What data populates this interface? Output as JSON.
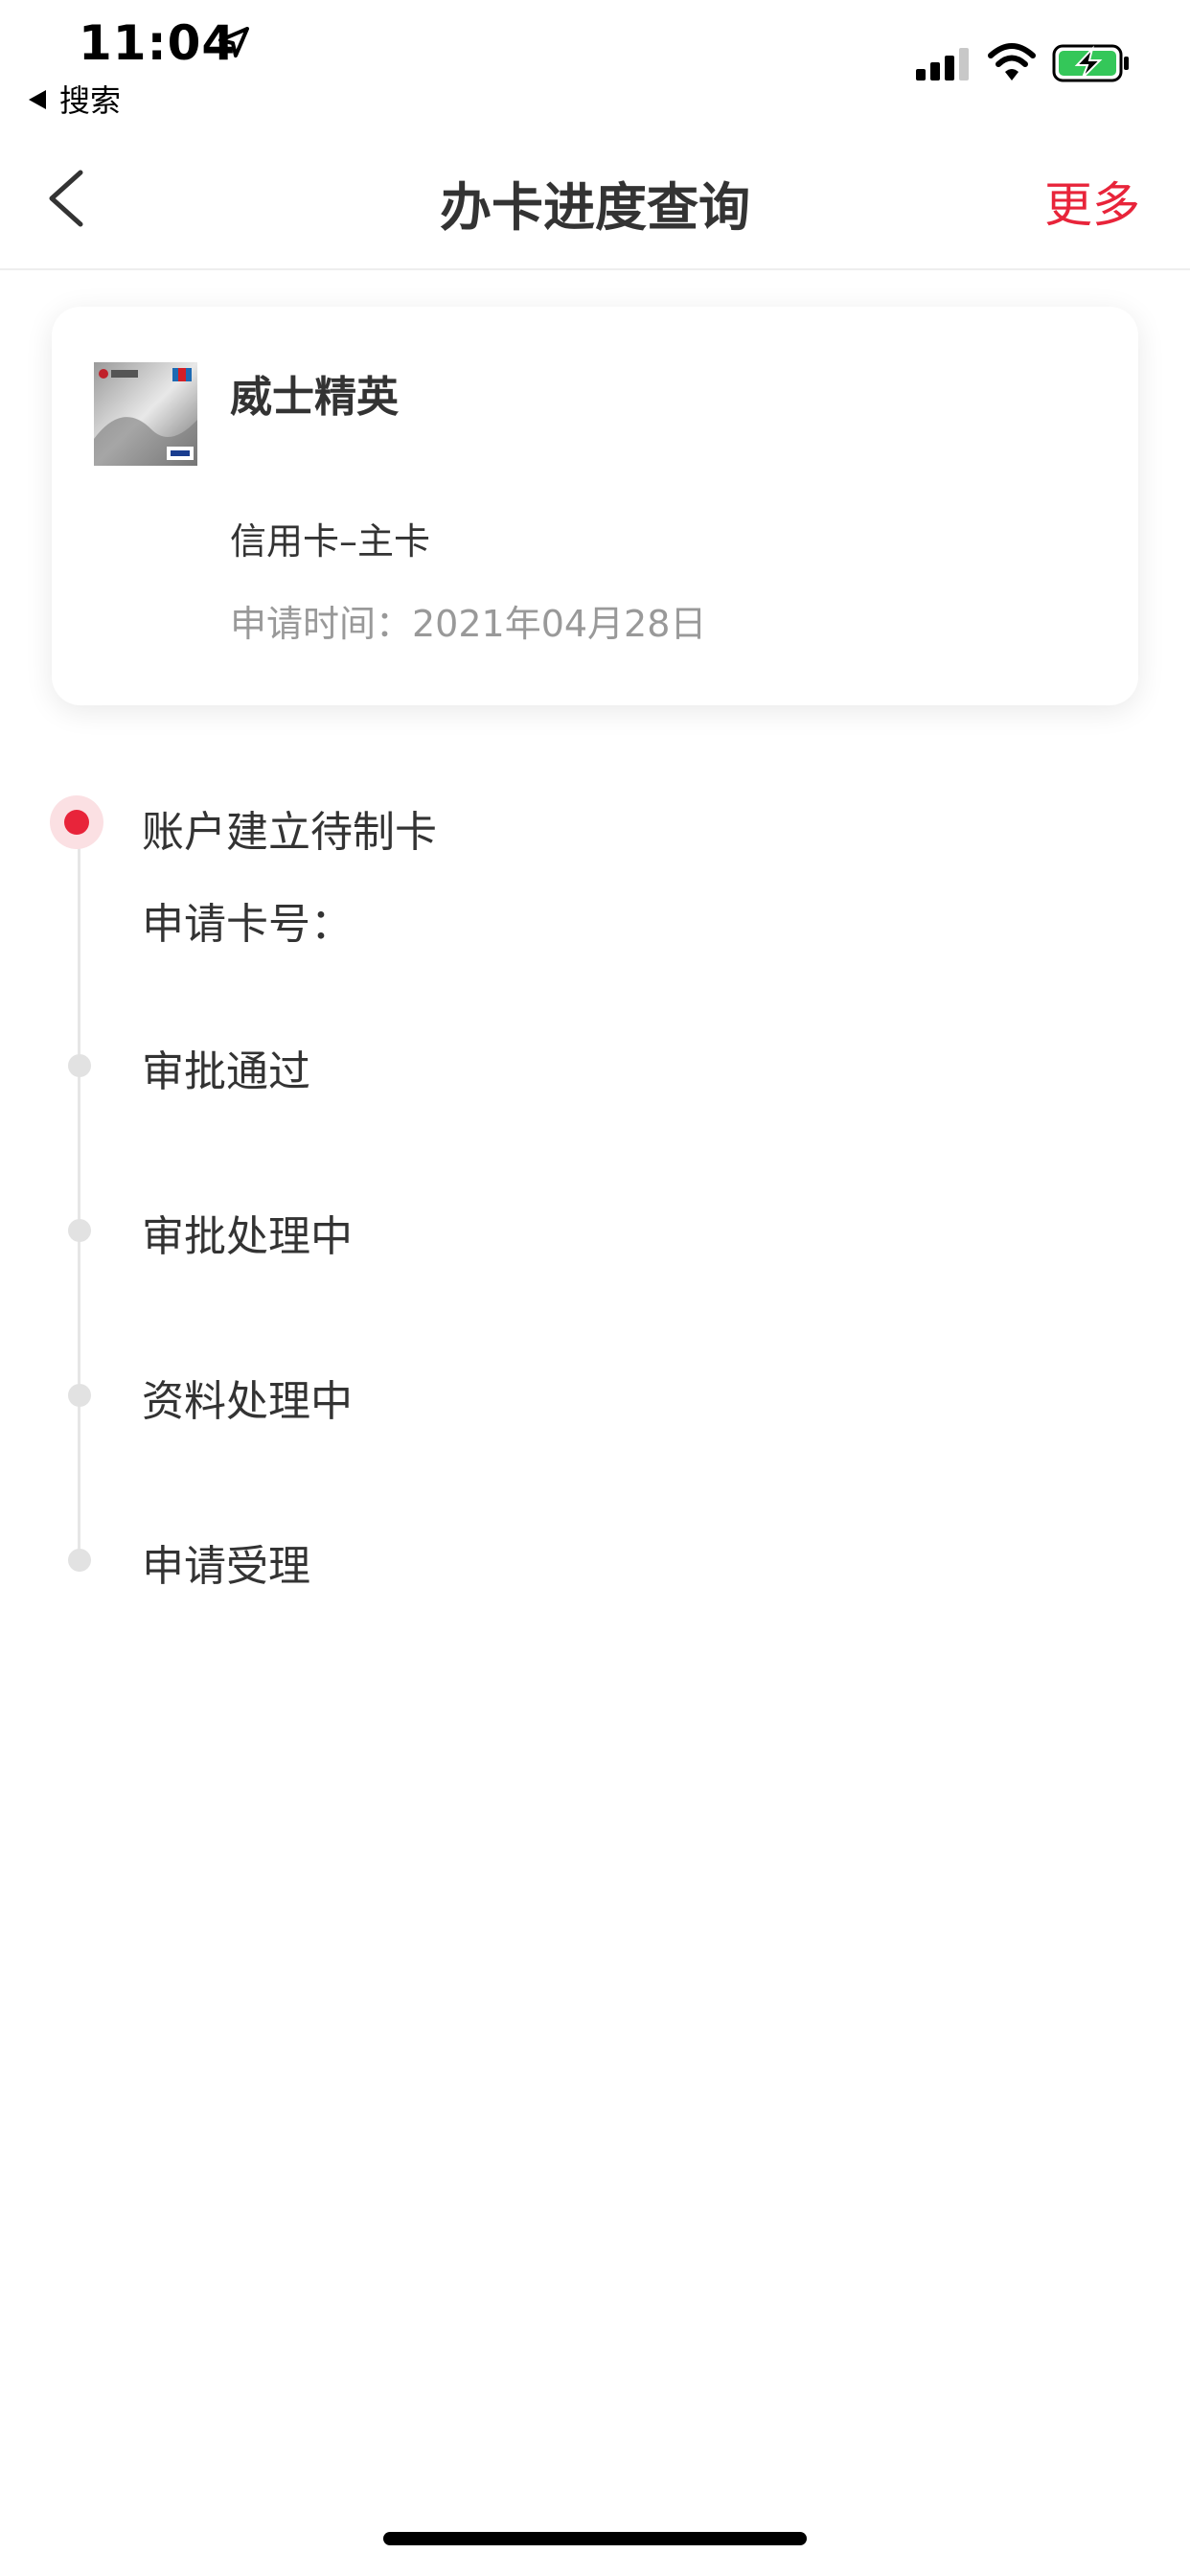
{
  "status_bar": {
    "time": "11:04",
    "back_app": "搜索",
    "icons": [
      "location-arrow-icon",
      "cellular-signal-icon",
      "wifi-icon",
      "battery-charging-icon"
    ]
  },
  "nav": {
    "title": "办卡进度查询",
    "more": "更多",
    "back_icon": "chevron-left-icon"
  },
  "card": {
    "name": "威士精英",
    "type": "信用卡–主卡",
    "date": "申请时间：2021年04月28日"
  },
  "timeline": {
    "current": {
      "status": "账户建立待制卡",
      "card_number_label": "申请卡号："
    },
    "steps": [
      "审批通过",
      "审批处理中",
      "资料处理中",
      "申请受理"
    ]
  },
  "colors": {
    "accent": "#e8243a",
    "text": "#333333",
    "muted": "#999999",
    "timeline": "#e2e2e2"
  }
}
